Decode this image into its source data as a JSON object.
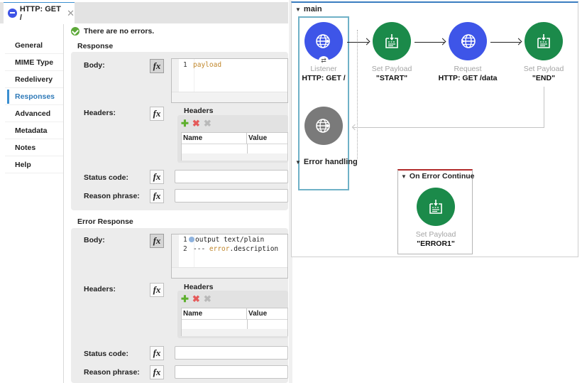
{
  "editor_tab": {
    "title": "HTTP: GET /",
    "icon": "globe-icon",
    "close_icon": "close-icon"
  },
  "status": {
    "icon": "check-circle-icon",
    "message": "There are no errors."
  },
  "sidebar": {
    "items": [
      {
        "label": "General",
        "active": false
      },
      {
        "label": "MIME Type",
        "active": false
      },
      {
        "label": "Redelivery",
        "active": false
      },
      {
        "label": "Responses",
        "active": true
      },
      {
        "label": "Advanced",
        "active": false
      },
      {
        "label": "Metadata",
        "active": false
      },
      {
        "label": "Notes",
        "active": false
      },
      {
        "label": "Help",
        "active": false
      }
    ]
  },
  "response": {
    "section_title": "Response",
    "body_label": "Body:",
    "body_code": [
      {
        "line": "1",
        "text": "payload"
      }
    ],
    "headers_label": "Headers:",
    "headers_table_title": "Headers",
    "headers_columns": [
      "Name",
      "Value"
    ],
    "headers_rows": [],
    "status_code_label": "Status code:",
    "status_code_value": "",
    "reason_phrase_label": "Reason phrase:",
    "reason_phrase_value": "",
    "fx_label": "fx"
  },
  "error_response": {
    "section_title": "Error Response",
    "body_label": "Body:",
    "body_code": [
      {
        "line": "1",
        "text": "output text/plain"
      },
      {
        "line": "2",
        "prefix": "--- ",
        "keyword": "error",
        "suffix": ".description"
      }
    ],
    "headers_label": "Headers:",
    "headers_table_title": "Headers",
    "headers_columns": [
      "Name",
      "Value"
    ],
    "headers_rows": [],
    "status_code_label": "Status code:",
    "status_code_value": "",
    "reason_phrase_label": "Reason phrase:",
    "reason_phrase_value": "",
    "fx_label": "fx"
  },
  "header_tools": {
    "add": "✚",
    "remove": "✖",
    "clear": "✖"
  },
  "flow": {
    "name": "main",
    "nodes": [
      {
        "type": "Listener",
        "name": "HTTP: GET /",
        "color": "#3e55e8",
        "icon": "globe-listener-icon"
      },
      {
        "type": "Set Payload",
        "name": "\"START\"",
        "color": "#1b8a4a",
        "icon": "set-payload-icon"
      },
      {
        "type": "Request",
        "name": "HTTP: GET /data",
        "color": "#3e55e8",
        "icon": "globe-request-icon"
      },
      {
        "type": "Set Payload",
        "name": "\"END\"",
        "color": "#1b8a4a",
        "icon": "set-payload-icon"
      }
    ],
    "response_node": {
      "icon": "globe-response-icon",
      "color": "#7a7a7a"
    },
    "error_handling": {
      "title": "Error handling",
      "handler": {
        "title": "On Error Continue",
        "node": {
          "type": "Set Payload",
          "name": "\"ERROR1\"",
          "color": "#1b8a4a",
          "icon": "set-payload-icon"
        }
      }
    }
  }
}
